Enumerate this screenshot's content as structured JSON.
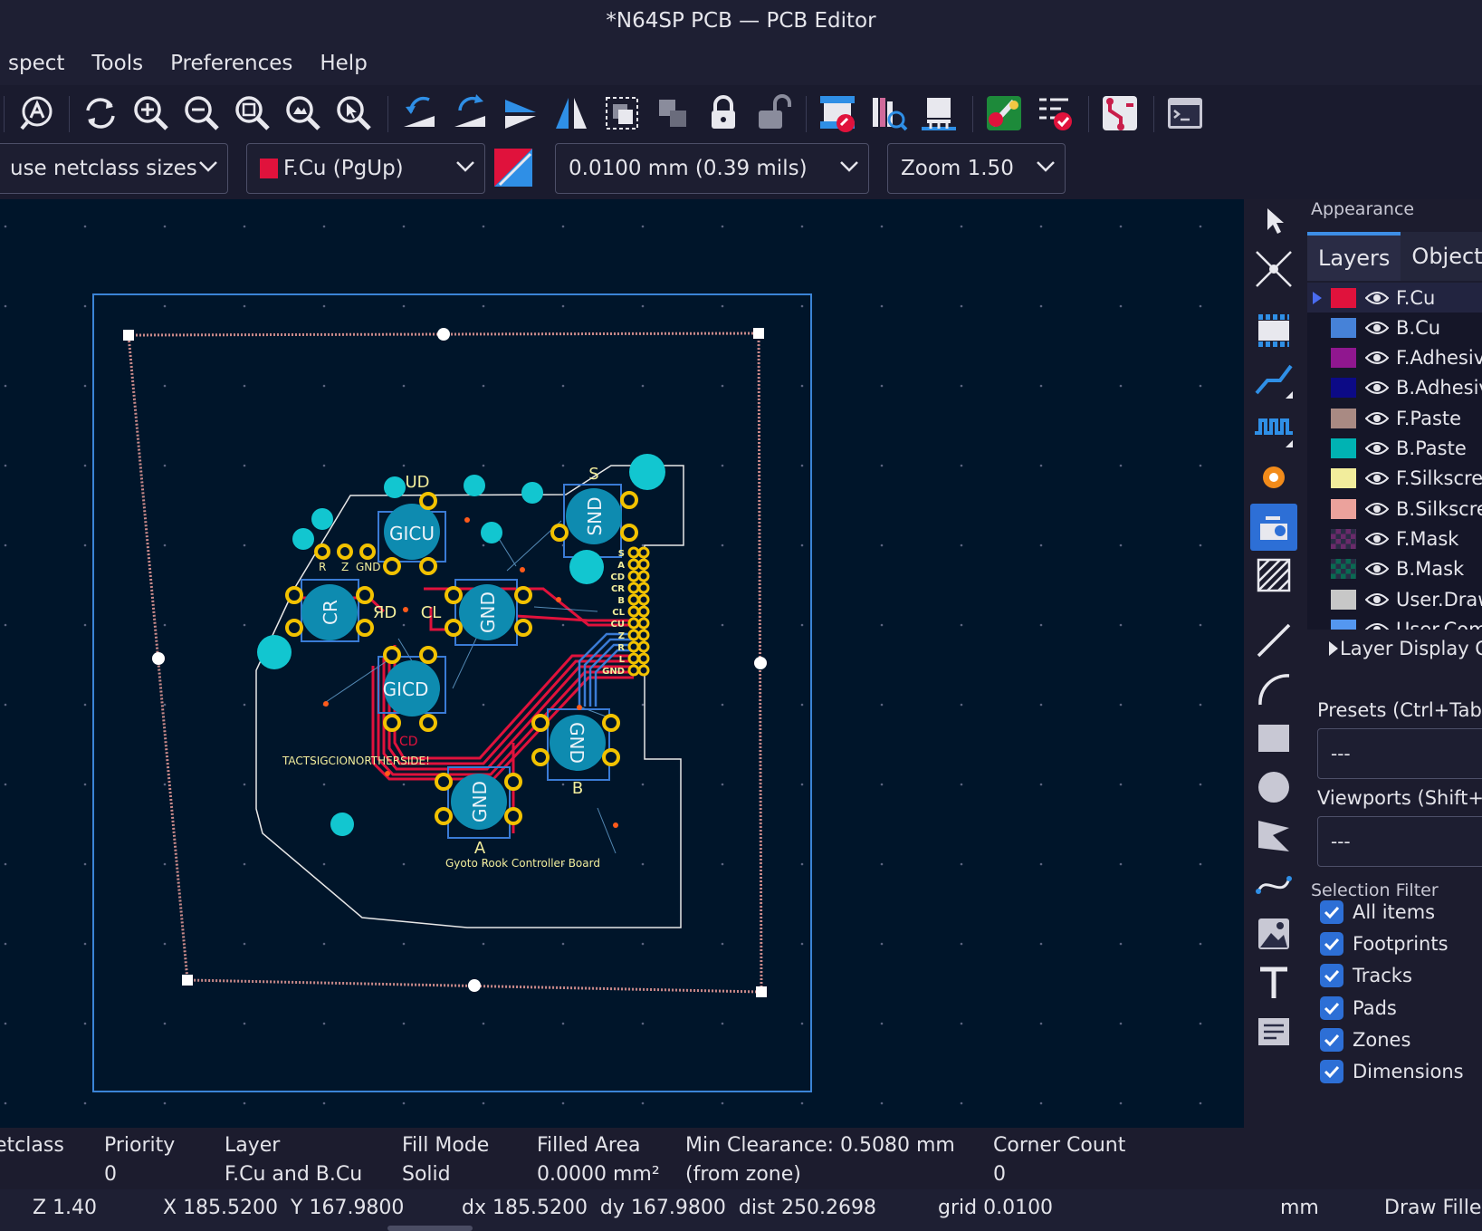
{
  "window": {
    "title": "*N64SP PCB — PCB Editor"
  },
  "menubar": {
    "items": [
      "spect",
      "Tools",
      "Preferences",
      "Help"
    ]
  },
  "toolbar": {
    "icons": [
      "autoroute-icon",
      "refresh-icon",
      "zoom-in-icon",
      "zoom-out-icon",
      "zoom-fit-icon",
      "zoom-objects-icon",
      "zoom-selection-icon",
      "rotate-ccw-icon",
      "rotate-cw-icon",
      "flip-icon",
      "mirror-icon",
      "group-icon",
      "ungroup-icon",
      "lock-icon",
      "unlock-icon",
      "update-pcb-icon",
      "footprint-browser-icon",
      "footprint-editor-icon",
      "board-setup-icon",
      "drc-icon",
      "net-inspector-icon",
      "scripting-console-icon"
    ]
  },
  "options": {
    "track_width": "use netclass sizes",
    "layer": "F.Cu (PgUp)",
    "layer_color": "#e0123c",
    "grid": "0.0100 mm (0.39 mils)",
    "zoom": "Zoom 1.50"
  },
  "board": {
    "labels": {
      "gcu": "GICU",
      "cu": "UD",
      "s": "S",
      "snd": "SND",
      "cr": "CR",
      "cr2": "ЯD",
      "cl": "CL",
      "gnd1": "GND",
      "gnd2": "GND",
      "gnd3": "GND",
      "gcd": "GICD",
      "b": "B",
      "a": "A",
      "r_label": "R",
      "z_label": "Z",
      "gnd_label": "GND",
      "tact": "TACTSIGCIONORTHERSIDE!",
      "cd_label": "CD",
      "board_name": "Gyoto Rook Controller Board",
      "conn_pins": [
        "S",
        "A",
        "CD",
        "CR",
        "B",
        "CL",
        "CU",
        "Z",
        "R",
        "L",
        "GND"
      ]
    }
  },
  "right_tools": [
    "select-arrow-icon",
    "local-ratsnest-icon",
    "add-footprint-icon",
    "route-track-icon",
    "tune-length-icon",
    "add-via-icon",
    "add-zone-icon",
    "add-rule-area-icon",
    "draw-line-icon",
    "draw-arc-icon",
    "draw-rectangle-icon",
    "draw-circle-icon",
    "draw-polygon-icon",
    "draw-bezier-icon",
    "add-image-icon",
    "add-text-icon",
    "add-textbox-icon"
  ],
  "appearance": {
    "title": "Appearance",
    "tabs": [
      "Layers",
      "Objects"
    ],
    "layers": [
      {
        "name": "F.Cu",
        "color": "#e0123c"
      },
      {
        "name": "B.Cu",
        "color": "#4682d8"
      },
      {
        "name": "F.Adhesive",
        "color": "#90178f"
      },
      {
        "name": "B.Adhesive",
        "color": "#0c0a86"
      },
      {
        "name": "F.Paste",
        "color": "#a98a83"
      },
      {
        "name": "B.Paste",
        "color": "#00b3b3"
      },
      {
        "name": "F.Silkscreen",
        "color": "#f2ed9c"
      },
      {
        "name": "B.Silkscreen",
        "color": "#eba29c"
      },
      {
        "name": "F.Mask",
        "color": "#6a2a6a"
      },
      {
        "name": "B.Mask",
        "color": "#0a6a52"
      },
      {
        "name": "User.Drawings",
        "color": "#c7c7c7"
      },
      {
        "name": "User.Comments",
        "color": "#5497f0"
      }
    ],
    "layer_display_options": "Layer Display Options",
    "presets_label": "Presets (Ctrl+Tab):",
    "presets_value": "---",
    "viewports_label": "Viewports (Shift+Tab):",
    "viewports_value": "---"
  },
  "selection_filter": {
    "title": "Selection Filter",
    "items": [
      "All items",
      "Footprints",
      "Tracks",
      "Pads",
      "Zones",
      "Dimensions"
    ]
  },
  "message_panel": [
    {
      "label": "etclass",
      "value": ""
    },
    {
      "label": "Priority",
      "value": "0"
    },
    {
      "label": "Layer",
      "value": "F.Cu and B.Cu"
    },
    {
      "label": "Fill Mode",
      "value": "Solid"
    },
    {
      "label": "Filled Area",
      "value": "0.0000 mm²"
    },
    {
      "label": "Min Clearance: 0.5080 mm",
      "value": "(from zone)"
    },
    {
      "label": "Corner Count",
      "value": "0"
    }
  ],
  "status": {
    "zoom": "Z 1.40",
    "xy": "X 185.5200  Y 167.9800",
    "delta": "dx 185.5200  dy 167.9800  dist 250.2698",
    "grid": "grid 0.0100",
    "units": "mm",
    "mode": "Draw Filled"
  }
}
